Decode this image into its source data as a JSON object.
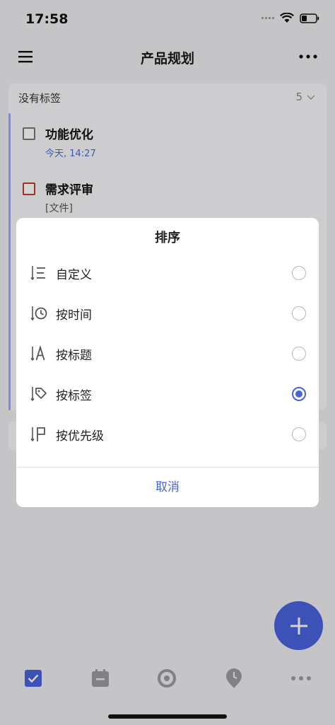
{
  "status": {
    "time": "17:58"
  },
  "header": {
    "title": "产品规划"
  },
  "group": {
    "name": "没有标签",
    "count": "5",
    "tasks": [
      {
        "title": "功能优化",
        "subtitle": "今天, 14:27"
      },
      {
        "title": "需求评审",
        "subtitle": "[文件]"
      }
    ]
  },
  "sort_sheet": {
    "title": "排序",
    "options": [
      {
        "label": "自定义",
        "icon": "custom-sort-icon",
        "selected": false
      },
      {
        "label": "按时间",
        "icon": "clock-sort-icon",
        "selected": false
      },
      {
        "label": "按标题",
        "icon": "title-sort-icon",
        "selected": false
      },
      {
        "label": "按标签",
        "icon": "tag-sort-icon",
        "selected": true
      },
      {
        "label": "按优先级",
        "icon": "priority-sort-icon",
        "selected": false
      }
    ],
    "cancel_label": "取消"
  },
  "colors": {
    "accent": "#4a63db",
    "date_blue": "#4a6dd6",
    "priority_red": "#c03a2b"
  },
  "tabbar": {
    "tabs": [
      "task-check-icon",
      "calendar-icon",
      "focus-icon",
      "habit-pin-icon",
      "more-dots-icon"
    ],
    "active": "task-check-icon"
  }
}
